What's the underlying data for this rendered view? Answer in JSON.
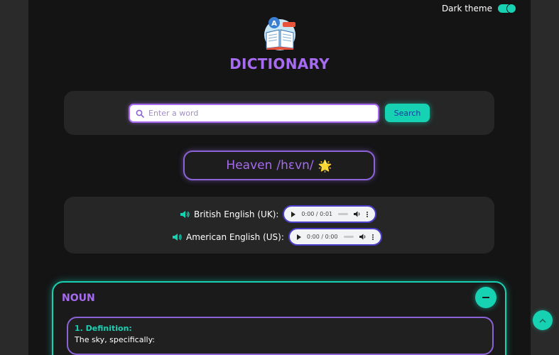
{
  "header": {
    "theme_label": "Dark theme",
    "theme_enabled": true,
    "app_title": "DICTIONARY",
    "logo_icon": "dictionary-book-icon"
  },
  "search": {
    "placeholder": "Enter a word",
    "value": "",
    "button_label": "Search",
    "icon": "search-icon"
  },
  "word": {
    "headword": "Heaven",
    "phonetic": "/hɛvn/",
    "emoji": "🌟"
  },
  "pronunciations": [
    {
      "label": "British English (UK):",
      "time": "0:00 / 0:01",
      "icon": "speaker-icon"
    },
    {
      "label": "American English (US):",
      "time": "0:00 / 0:00",
      "icon": "speaker-icon"
    }
  ],
  "meanings": [
    {
      "part_of_speech": "NOUN",
      "definitions": [
        {
          "label": "1. Definition:",
          "text": "The sky, specifically:"
        }
      ]
    }
  ],
  "colors": {
    "accent_purple": "#a66bf0",
    "accent_teal": "#17d1b3",
    "background": "#141414"
  }
}
